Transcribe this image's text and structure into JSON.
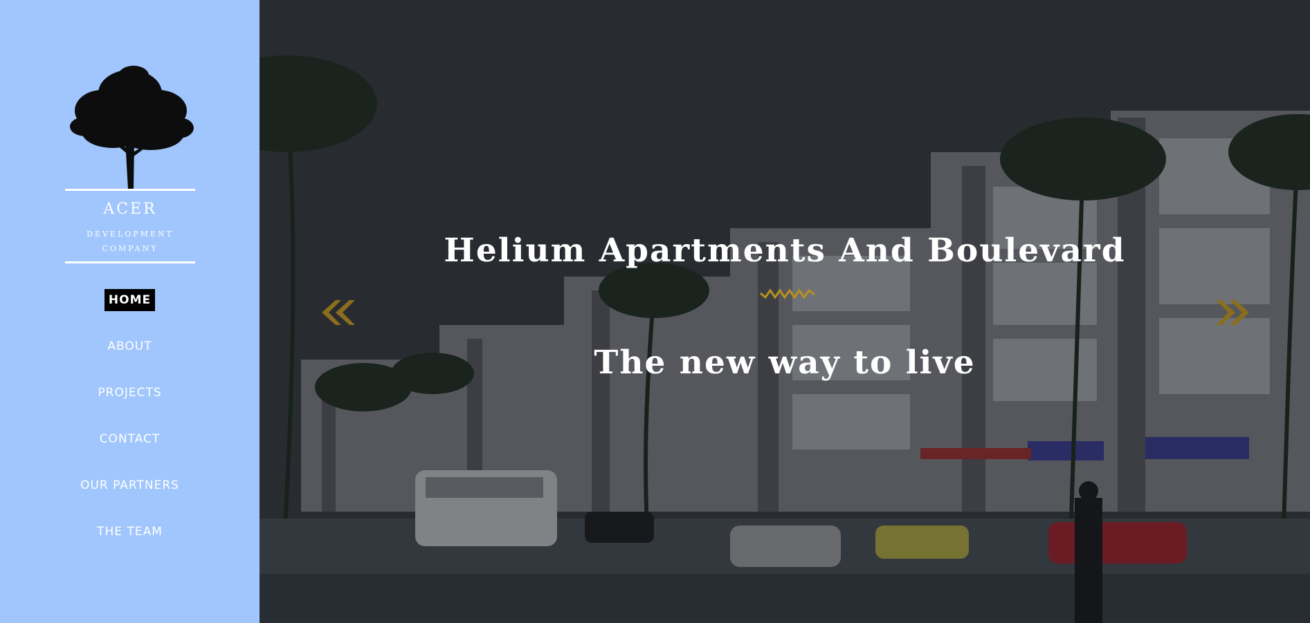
{
  "brand": {
    "name": "ACER",
    "subtitle_line1": "DEVELOPMENT",
    "subtitle_line2": "COMPANY",
    "logo_icon": "tree-icon"
  },
  "nav": {
    "items": [
      {
        "label": "HOME",
        "active": true
      },
      {
        "label": "ABOUT",
        "active": false
      },
      {
        "label": "PROJECTS",
        "active": false
      },
      {
        "label": "CONTACT",
        "active": false
      },
      {
        "label": "OUR PARTNERS",
        "active": false
      },
      {
        "label": "THE TEAM",
        "active": false
      }
    ]
  },
  "hero": {
    "title": "Helium Apartments And Boulevard",
    "subtitle": "The new way to live",
    "prev_icon": "double-chevron-left-icon",
    "next_icon": "double-chevron-right-icon",
    "divider_icon": "zigzag-divider-icon"
  },
  "colors": {
    "sidebar_bg": "#a0c6fd",
    "accent_gold": "#b8911f",
    "active_nav_bg": "#000000",
    "text_light": "#ffffff"
  }
}
